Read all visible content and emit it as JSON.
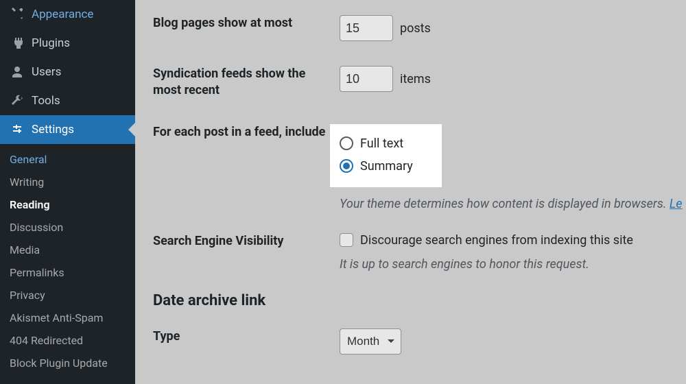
{
  "sidebar": {
    "items": [
      {
        "label": "Appearance",
        "icon": "appearance"
      },
      {
        "label": "Plugins",
        "icon": "plugins"
      },
      {
        "label": "Users",
        "icon": "users"
      },
      {
        "label": "Tools",
        "icon": "tools"
      },
      {
        "label": "Settings",
        "icon": "settings"
      }
    ],
    "submenu": [
      {
        "label": "General"
      },
      {
        "label": "Writing"
      },
      {
        "label": "Reading"
      },
      {
        "label": "Discussion"
      },
      {
        "label": "Media"
      },
      {
        "label": "Permalinks"
      },
      {
        "label": "Privacy"
      },
      {
        "label": "Akismet Anti-Spam"
      },
      {
        "label": "404 Redirected"
      },
      {
        "label": "Block Plugin Update"
      }
    ]
  },
  "settings": {
    "blogPages": {
      "label": "Blog pages show at most",
      "value": "15",
      "unit": "posts"
    },
    "syndication": {
      "label": "Syndication feeds show the most recent",
      "value": "10",
      "unit": "items"
    },
    "feedInclude": {
      "label": "For each post in a feed, include",
      "optionFull": "Full text",
      "optionSummary": "Summary",
      "descriptionPrefix": "Your theme determines how content is displayed in browsers. ",
      "descriptionLink": "Le"
    },
    "searchEngine": {
      "label": "Search Engine Visibility",
      "checkboxLabel": "Discourage search engines from indexing this site",
      "description": "It is up to search engines to honor this request."
    },
    "dateArchive": {
      "heading": "Date archive link",
      "typeLabel": "Type",
      "typeValue": "Month"
    }
  }
}
